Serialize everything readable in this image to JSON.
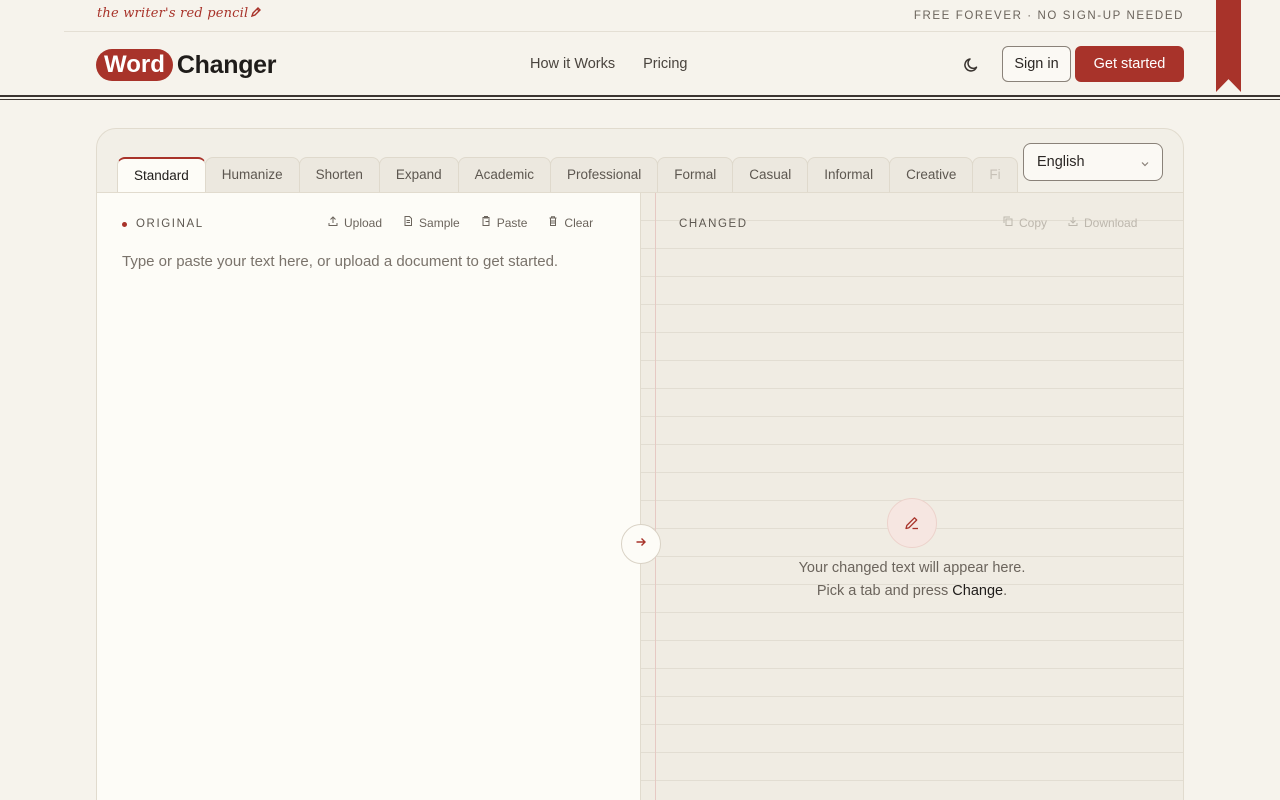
{
  "topbar": {
    "tagline": "the writer's red pencil",
    "badge": "FREE FOREVER · NO SIGN-UP NEEDED"
  },
  "header": {
    "logo_word": "Word",
    "logo_changer": "Changer",
    "nav": [
      "How it Works",
      "Pricing"
    ],
    "signin_label": "Sign in",
    "getstarted_label": "Get started"
  },
  "editor": {
    "tabs": [
      "Standard",
      "Humanize",
      "Shorten",
      "Expand",
      "Academic",
      "Professional",
      "Formal",
      "Casual",
      "Informal",
      "Creative",
      "Fi"
    ],
    "active_tab": "Standard",
    "language": "English",
    "original": {
      "label": "ORIGINAL",
      "tools": [
        "Upload",
        "Sample",
        "Paste",
        "Clear"
      ],
      "placeholder": "Type or paste your text here, or upload a document to get started."
    },
    "changed": {
      "label": "CHANGED",
      "tools": [
        "Copy",
        "Download"
      ],
      "empty_line1": "Your changed text will appear here.",
      "empty_line2_prefix": "Pick a tab and press ",
      "empty_line2_action": "Change",
      "empty_line2_suffix": "."
    }
  },
  "colors": {
    "accent": "#a8332a",
    "background": "#f6f3ec",
    "paper": "#fdfcf7"
  },
  "icons": [
    "pencil-icon",
    "moon-icon",
    "chevron-down-icon",
    "upload-icon",
    "document-icon",
    "clipboard-icon",
    "trash-icon",
    "copy-icon",
    "download-icon",
    "arrow-right-icon",
    "pen-icon"
  ]
}
